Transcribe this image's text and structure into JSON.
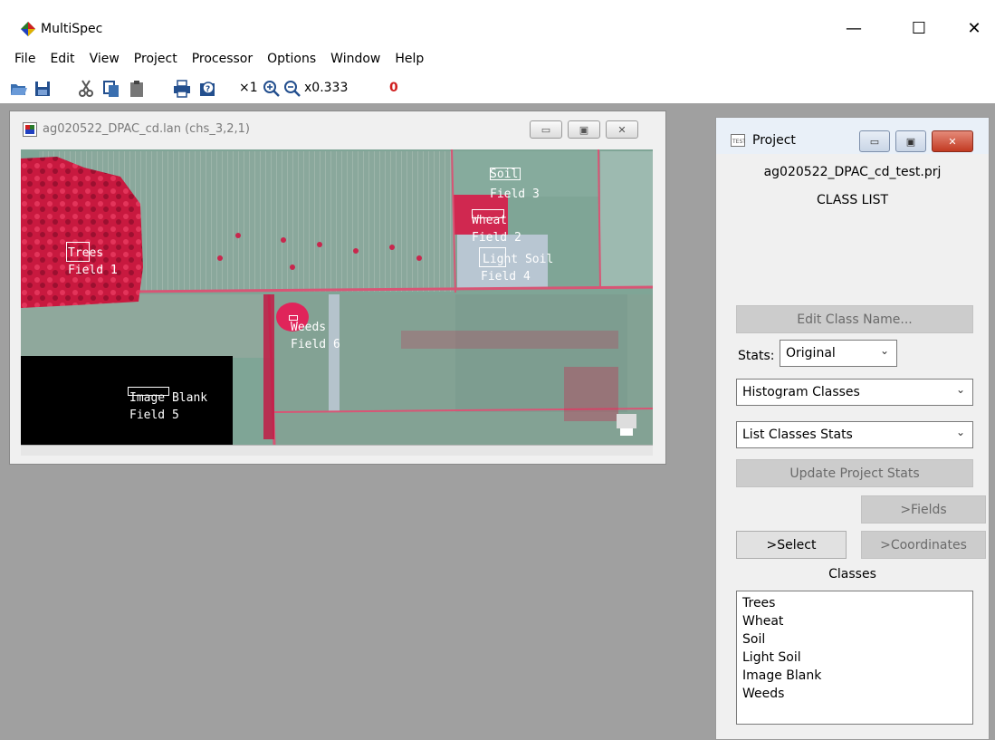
{
  "app": {
    "title": "MultiSpec"
  },
  "window_controls": {
    "minimize": "—",
    "maximize": "☐",
    "close": "✕"
  },
  "menu": [
    "File",
    "Edit",
    "View",
    "Project",
    "Processor",
    "Options",
    "Window",
    "Help"
  ],
  "toolbar": {
    "zoom_x1": "×1",
    "zoom_level": "x0.333",
    "overlay_label": "0"
  },
  "image_window": {
    "title": "ag020522_DPAC_cd.lan (chs_3,2,1)",
    "fields": [
      {
        "line1": "Soil",
        "line2": "Field 3"
      },
      {
        "line1": "Wheat",
        "line2": "Field 2"
      },
      {
        "line1": "Light Soil",
        "line2": "Field 4"
      },
      {
        "line1": "Trees",
        "line2": "Field 1"
      },
      {
        "line1": "Weeds",
        "line2": "Field 6"
      },
      {
        "line1": "Image Blank",
        "line2": "Field 5"
      }
    ]
  },
  "project_window": {
    "title": "Project",
    "file_name": "ag020522_DPAC_cd_test.prj",
    "list_heading": "CLASS LIST",
    "edit_class_name": "Edit Class Name...",
    "stats_label": "Stats:",
    "stats_value": "Original",
    "histogram_value": "Histogram Classes",
    "list_stats_value": "List Classes Stats",
    "update_stats": "Update Project Stats",
    "fields_button": ">Fields",
    "select_button": ">Select",
    "coordinates_button": ">Coordinates",
    "classes_label": "Classes",
    "classes": [
      "Trees",
      "Wheat",
      "Soil",
      "Light Soil",
      "Image Blank",
      "Weeds"
    ]
  },
  "colors": {
    "workspace": "#a0a0a0",
    "vegetation_red": "#e0204a",
    "field_green": "#7aa092"
  }
}
